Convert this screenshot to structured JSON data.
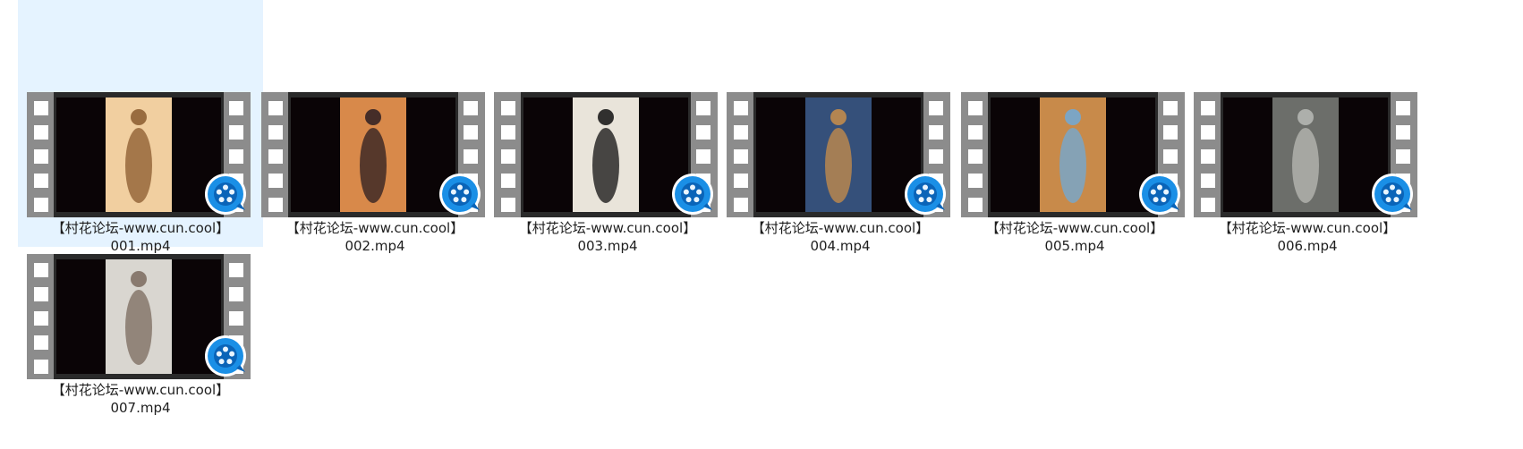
{
  "files": [
    {
      "label": "【村花论坛-www.cun.cool】",
      "name": "001.mp4",
      "selected": true,
      "frame": {
        "bg": "#f1cfa0",
        "accent": "#8a5a2e"
      },
      "icon": "media-player-icon"
    },
    {
      "label": "【村花论坛-www.cun.cool】",
      "name": "002.mp4",
      "selected": false,
      "frame": {
        "bg": "#d8894a",
        "accent": "#2b1d22"
      },
      "icon": "media-player-icon"
    },
    {
      "label": "【村花论坛-www.cun.cool】",
      "name": "003.mp4",
      "selected": false,
      "frame": {
        "bg": "#e9e4da",
        "accent": "#101010"
      },
      "icon": "media-player-icon"
    },
    {
      "label": "【村花论坛-www.cun.cool】",
      "name": "004.mp4",
      "selected": false,
      "frame": {
        "bg": "#35507a",
        "accent": "#c98e4a"
      },
      "icon": "media-player-icon"
    },
    {
      "label": "【村花论坛-www.cun.cool】",
      "name": "005.mp4",
      "selected": false,
      "frame": {
        "bg": "#c88a4a",
        "accent": "#6fa9d9"
      },
      "icon": "media-player-icon"
    },
    {
      "label": "【村花论坛-www.cun.cool】",
      "name": "006.mp4",
      "selected": false,
      "frame": {
        "bg": "#6c6e6a",
        "accent": "#b9bbb6"
      },
      "icon": "media-player-icon"
    },
    {
      "label": "【村花论坛-www.cun.cool】",
      "name": "007.mp4",
      "selected": false,
      "frame": {
        "bg": "#d9d6d0",
        "accent": "#7a6a5e"
      },
      "icon": "media-player-icon"
    }
  ]
}
